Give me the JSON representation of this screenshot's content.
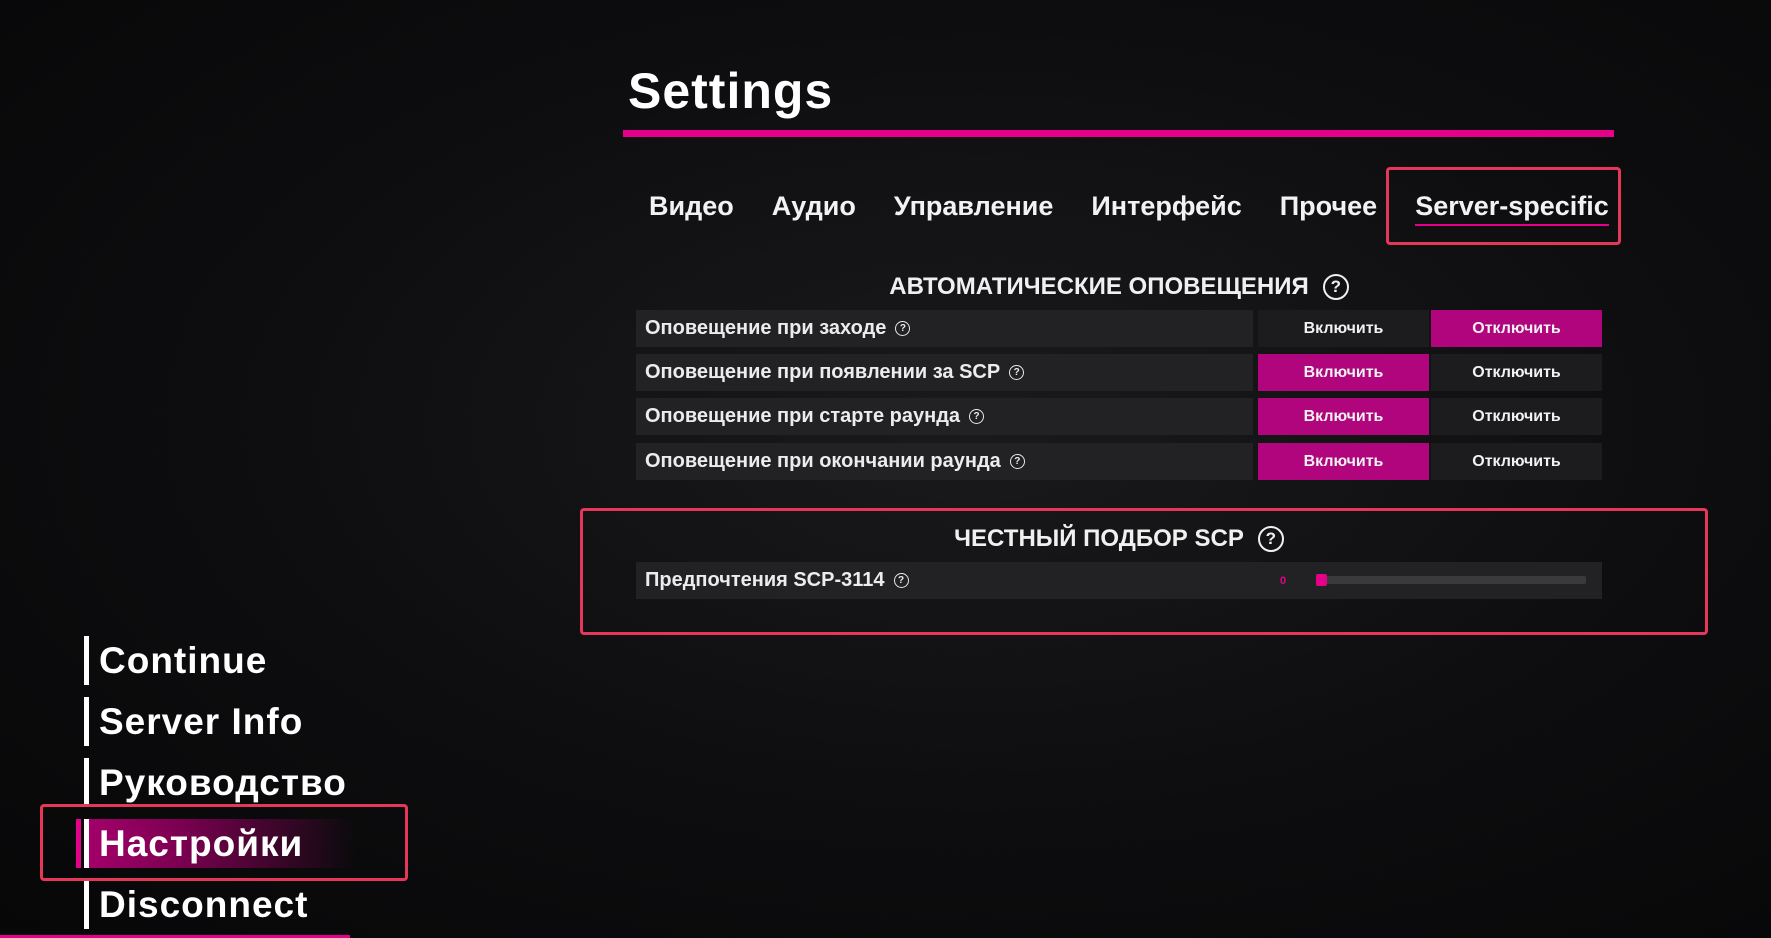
{
  "page_title": "Settings",
  "tabs": [
    {
      "label": "Видео"
    },
    {
      "label": "Аудио"
    },
    {
      "label": "Управление"
    },
    {
      "label": "Интерфейс"
    },
    {
      "label": "Прочее"
    },
    {
      "label": "Server-specific",
      "active": true
    }
  ],
  "sections": {
    "auto_notifications": {
      "title": "АВТОМАТИЧЕСКИЕ ОПОВЕЩЕНИЯ",
      "help_glyph": "?",
      "rows": [
        {
          "label": "Оповещение при заходе",
          "on_label": "Включить",
          "off_label": "Отключить",
          "selected": "off"
        },
        {
          "label": "Оповещение при появлении за SCP",
          "on_label": "Включить",
          "off_label": "Отключить",
          "selected": "on"
        },
        {
          "label": "Оповещение при старте раунда",
          "on_label": "Включить",
          "off_label": "Отключить",
          "selected": "on"
        },
        {
          "label": "Оповещение при окончании раунда",
          "on_label": "Включить",
          "off_label": "Отключить",
          "selected": "on"
        }
      ]
    },
    "fair_scp": {
      "title": "ЧЕСТНЫЙ ПОДБОР SCP",
      "help_glyph": "?",
      "slider": {
        "label": "Предпочтения SCP-3114",
        "value": "0",
        "fraction": 0
      }
    }
  },
  "menu": {
    "items": [
      {
        "label": "Continue"
      },
      {
        "label": "Server Info"
      },
      {
        "label": "Руководство"
      },
      {
        "label": "Настройки",
        "active": true
      },
      {
        "label": "Disconnect"
      }
    ]
  },
  "colors": {
    "accent": "#e5008a",
    "selected_button": "#b0057c",
    "highlight_box": "#e5375a"
  },
  "icons": {
    "help": "help-circle-icon"
  }
}
